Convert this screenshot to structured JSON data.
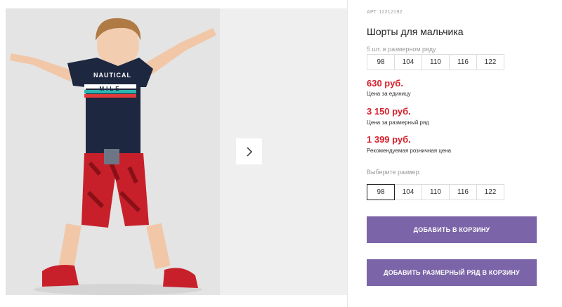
{
  "product": {
    "article_label": "АРТ",
    "article_number": "12212192",
    "title": "Шорты для мальчика",
    "grid_label": "5 шт. в размерном ряду",
    "grid_sizes": [
      "98",
      "104",
      "110",
      "116",
      "122"
    ]
  },
  "prices": {
    "unit_price": "630 руб.",
    "unit_label": "Цена за единицу",
    "grid_price": "3 150 руб.",
    "grid_price_label": "Цена за размерный ряд",
    "retail_price": "1 399 руб.",
    "retail_label": "Рекомендуемая розничная цена"
  },
  "size_selector": {
    "label": "Выберите размер:",
    "sizes": [
      "98",
      "104",
      "110",
      "116",
      "122"
    ],
    "selected": "98"
  },
  "buttons": {
    "add_to_cart": "ДОБАВИТЬ В КОРЗИНУ",
    "add_grid_to_cart": "ДОБАВИТЬ РАЗМЕРНЫЙ РЯД В КОРЗИНУ"
  },
  "colors": {
    "accent_button": "#7b65a8",
    "price": "#d5202b"
  },
  "gallery": {
    "next_icon": "chevron-right-icon",
    "shirt_print_line1": "NAUTICAL",
    "shirt_print_line2": "MILE"
  }
}
